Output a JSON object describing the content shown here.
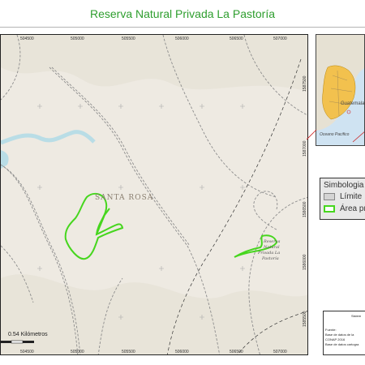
{
  "title": "Reserva Natural Privada La Pastoría",
  "map": {
    "place_label": "SANTA ROSA",
    "reserve_label_line1": "Reserva",
    "reserve_label_line2": "Natural",
    "reserve_label_line3": "Privada La",
    "reserve_label_line4": "Pastoría",
    "x_ticks": [
      "504500",
      "505000",
      "505500",
      "506000",
      "506500",
      "507000"
    ],
    "x_ticks_bottom": [
      "504500",
      "505000",
      "505500",
      "506000",
      "506500",
      "507000"
    ],
    "y_ticks_right": [
      "1587500",
      "1587000",
      "1586500",
      "1586000",
      "1585500"
    ],
    "colors": {
      "background": "#eeeae2",
      "area": "#46d61e",
      "road": "#8c8c8c",
      "water": "#b9dde6"
    }
  },
  "inset": {
    "label": "Guatemala",
    "label2": "Oceano Pacifico",
    "colors": {
      "sea": "#cfe3f2",
      "land": "#e6e1d3",
      "country": "#f2c14e"
    }
  },
  "legend": {
    "title": "Simbologia",
    "items": [
      {
        "label": "Límite",
        "color": "#bdbdbd"
      },
      {
        "label": "Área pr",
        "color": "#46d61e"
      }
    ]
  },
  "scale_bar": {
    "label": "0.54 Kilómetros"
  },
  "info": {
    "line1": "Sistem",
    "line2": "Fuente:",
    "line3": "Base de datos de la",
    "line4": "CONAP 2016",
    "line5": "Base de datos cartogra"
  }
}
